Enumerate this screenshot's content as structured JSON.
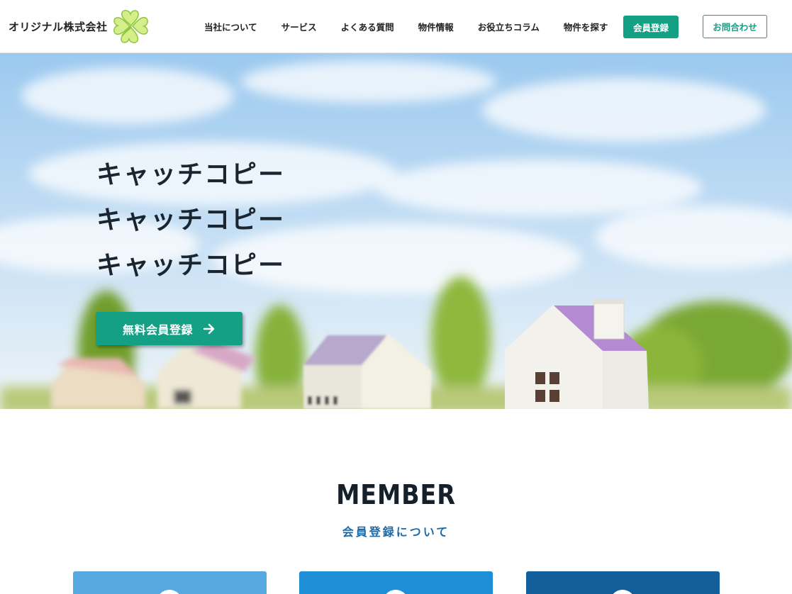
{
  "header": {
    "logo_text": "オリジナル株式会社",
    "logo_icon": "clover-icon",
    "nav": [
      {
        "label": "当社について"
      },
      {
        "label": "サービス"
      },
      {
        "label": "よくある質問"
      },
      {
        "label": "物件情報"
      },
      {
        "label": "お役立ちコラム"
      },
      {
        "label": "物件を探す"
      }
    ],
    "register_label": "会員登録",
    "contact_label": "お問合わせ"
  },
  "hero": {
    "catch_lines": [
      "キャッチコピー",
      "キャッチコピー",
      "キャッチコピー"
    ],
    "cta_label": "無料会員登録",
    "cta_icon": "arrow-right-icon"
  },
  "member": {
    "title": "MEMBER",
    "subtitle": "会員登録について"
  },
  "colors": {
    "accent": "#14a085",
    "card_light": "#56a9df",
    "card_mid": "#1e8ed6",
    "card_dark": "#125f9c",
    "subtitle": "#1f6aa5"
  }
}
